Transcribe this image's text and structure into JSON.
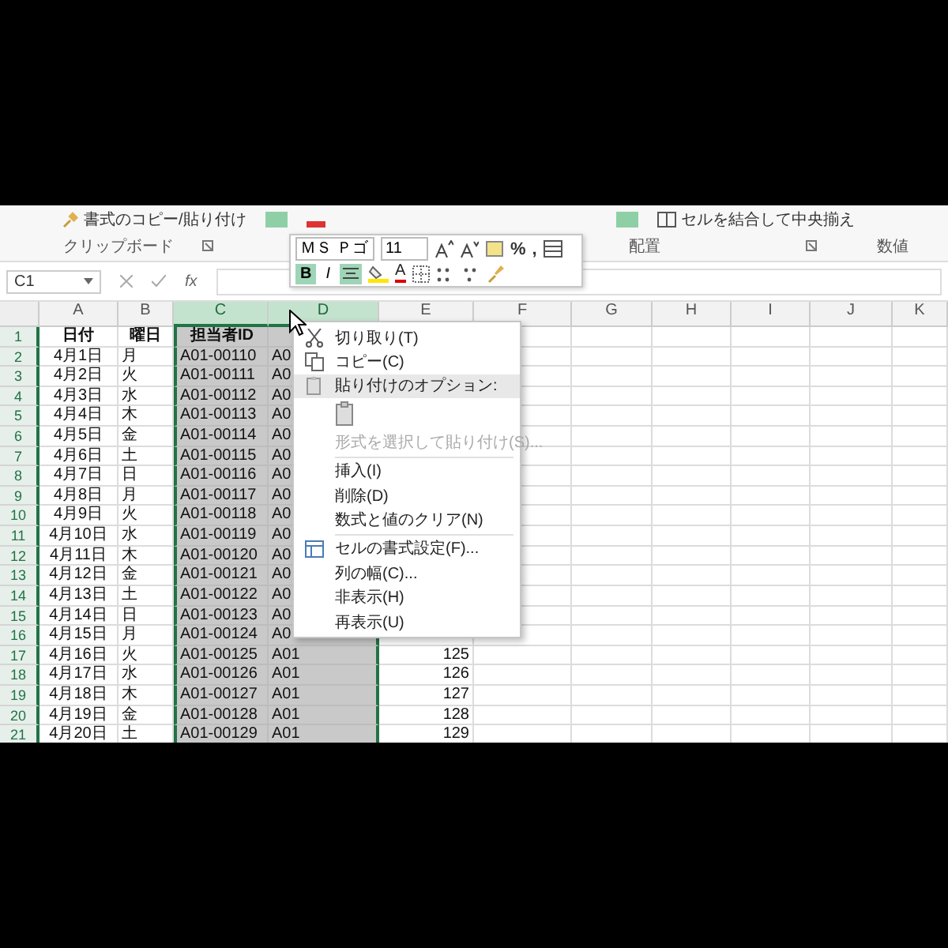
{
  "ribbon": {
    "format_painter": "書式のコピー/貼り付け",
    "merge_center": "セルを結合して中央揃え",
    "groups": [
      "クリップボード",
      "配置",
      "数値"
    ]
  },
  "mini_toolbar": {
    "font": "ＭＳ Ｐゴ",
    "size": "11",
    "percent": "%",
    "comma": ",",
    "bold_label": "B",
    "italic_label": "I",
    "font_color_label": "A",
    "bold": true,
    "center": true
  },
  "formula_bar": {
    "name_box": "C1",
    "fx": "fx"
  },
  "columns": [
    {
      "label": "A",
      "selected": false
    },
    {
      "label": "B",
      "selected": false
    },
    {
      "label": "C",
      "selected": true
    },
    {
      "label": "D",
      "selected": true
    },
    {
      "label": "E",
      "selected": false
    },
    {
      "label": "F",
      "selected": false
    },
    {
      "label": "G",
      "selected": false
    },
    {
      "label": "H",
      "selected": false
    },
    {
      "label": "I",
      "selected": false
    },
    {
      "label": "J",
      "selected": false
    },
    {
      "label": "K",
      "selected": false
    }
  ],
  "rows": [
    {
      "num": "1",
      "kind": "header",
      "cells": [
        "日付",
        "曜日",
        "担当者ID"
      ]
    },
    {
      "num": "2",
      "kind": "data",
      "cells": [
        "4月1日",
        "月",
        "A01-00110",
        "A0"
      ]
    },
    {
      "num": "3",
      "kind": "data",
      "cells": [
        "4月2日",
        "火",
        "A01-00111",
        "A0"
      ]
    },
    {
      "num": "4",
      "kind": "data",
      "cells": [
        "4月3日",
        "水",
        "A01-00112",
        "A0"
      ]
    },
    {
      "num": "5",
      "kind": "data",
      "cells": [
        "4月4日",
        "木",
        "A01-00113",
        "A0"
      ]
    },
    {
      "num": "6",
      "kind": "data",
      "cells": [
        "4月5日",
        "金",
        "A01-00114",
        "A0"
      ]
    },
    {
      "num": "7",
      "kind": "data",
      "cells": [
        "4月6日",
        "土",
        "A01-00115",
        "A0"
      ]
    },
    {
      "num": "8",
      "kind": "data",
      "cells": [
        "4月7日",
        "日",
        "A01-00116",
        "A0"
      ]
    },
    {
      "num": "9",
      "kind": "data",
      "cells": [
        "4月8日",
        "月",
        "A01-00117",
        "A0"
      ]
    },
    {
      "num": "10",
      "kind": "data",
      "cells": [
        "4月9日",
        "火",
        "A01-00118",
        "A0"
      ]
    },
    {
      "num": "11",
      "kind": "data",
      "cells": [
        "4月10日",
        "水",
        "A01-00119",
        "A0"
      ]
    },
    {
      "num": "12",
      "kind": "data",
      "cells": [
        "4月11日",
        "木",
        "A01-00120",
        "A0"
      ]
    },
    {
      "num": "13",
      "kind": "data",
      "cells": [
        "4月12日",
        "金",
        "A01-00121",
        "A0"
      ]
    },
    {
      "num": "14",
      "kind": "data",
      "cells": [
        "4月13日",
        "土",
        "A01-00122",
        "A0"
      ]
    },
    {
      "num": "15",
      "kind": "data",
      "cells": [
        "4月14日",
        "日",
        "A01-00123",
        "A0"
      ]
    },
    {
      "num": "16",
      "kind": "data",
      "cells": [
        "4月15日",
        "月",
        "A01-00124",
        "A0"
      ]
    },
    {
      "num": "17",
      "kind": "data",
      "cells": [
        "4月16日",
        "火",
        "A01-00125",
        "A01",
        "125"
      ]
    },
    {
      "num": "18",
      "kind": "data",
      "cells": [
        "4月17日",
        "水",
        "A01-00126",
        "A01",
        "126"
      ]
    },
    {
      "num": "19",
      "kind": "data",
      "cells": [
        "4月18日",
        "木",
        "A01-00127",
        "A01",
        "127"
      ]
    },
    {
      "num": "20",
      "kind": "data",
      "cells": [
        "4月19日",
        "金",
        "A01-00128",
        "A01",
        "128"
      ]
    },
    {
      "num": "21",
      "kind": "data",
      "cells": [
        "4月20日",
        "土",
        "A01-00129",
        "A01",
        "129"
      ]
    }
  ],
  "context_menu": {
    "items": [
      {
        "kind": "cut",
        "label": "切り取り(T)",
        "disabled": false
      },
      {
        "kind": "copy",
        "label": "コピー(C)",
        "disabled": false
      },
      {
        "kind": "section",
        "label": "貼り付けのオプション:",
        "disabled": false
      },
      {
        "kind": "paste-choice",
        "disabled": false
      },
      {
        "kind": "command",
        "label": "形式を選択して貼り付け(S)...",
        "disabled": true
      },
      {
        "kind": "separator"
      },
      {
        "kind": "command",
        "label": "挿入(I)",
        "disabled": false
      },
      {
        "kind": "command",
        "label": "削除(D)",
        "disabled": false
      },
      {
        "kind": "command",
        "label": "数式と値のクリア(N)",
        "disabled": false
      },
      {
        "kind": "separator"
      },
      {
        "kind": "format",
        "label": "セルの書式設定(F)...",
        "disabled": false
      },
      {
        "kind": "command",
        "label": "列の幅(C)...",
        "disabled": false
      },
      {
        "kind": "command",
        "label": "非表示(H)",
        "disabled": false
      },
      {
        "kind": "command",
        "label": "再表示(U)",
        "disabled": false
      }
    ]
  }
}
